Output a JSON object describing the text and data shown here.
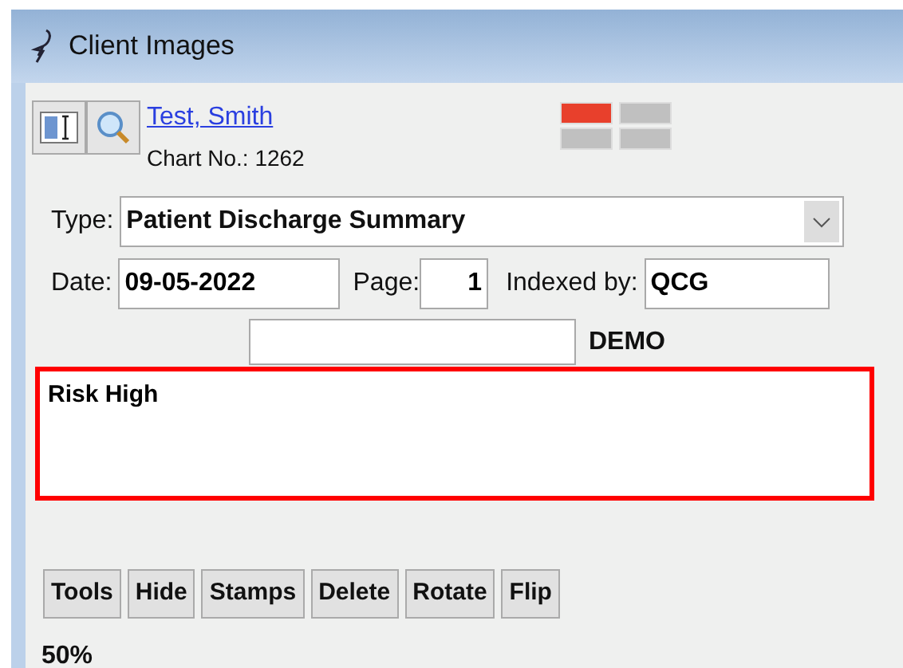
{
  "window": {
    "title": "Client Images"
  },
  "patient": {
    "name": "Test, Smith",
    "chart_label": "Chart No.:",
    "chart_number": "1262"
  },
  "indicators": [
    {
      "color": "#e8402c"
    },
    {
      "color": "#c0c0c0"
    },
    {
      "color": "#c0c0c0"
    },
    {
      "color": "#c0c0c0"
    }
  ],
  "type": {
    "label": "Type:",
    "value": "Patient Discharge Summary"
  },
  "date": {
    "label": "Date:",
    "value": "09-05-2022"
  },
  "page": {
    "label": "Page:",
    "value": "1"
  },
  "indexed_by": {
    "label": "Indexed by:",
    "value": "QCG"
  },
  "demo_label": "DEMO",
  "notes": {
    "value": "Risk High"
  },
  "buttons": [
    "Tools",
    "Hide",
    "Stamps",
    "Delete",
    "Rotate",
    "Flip"
  ],
  "zoom": "50%"
}
